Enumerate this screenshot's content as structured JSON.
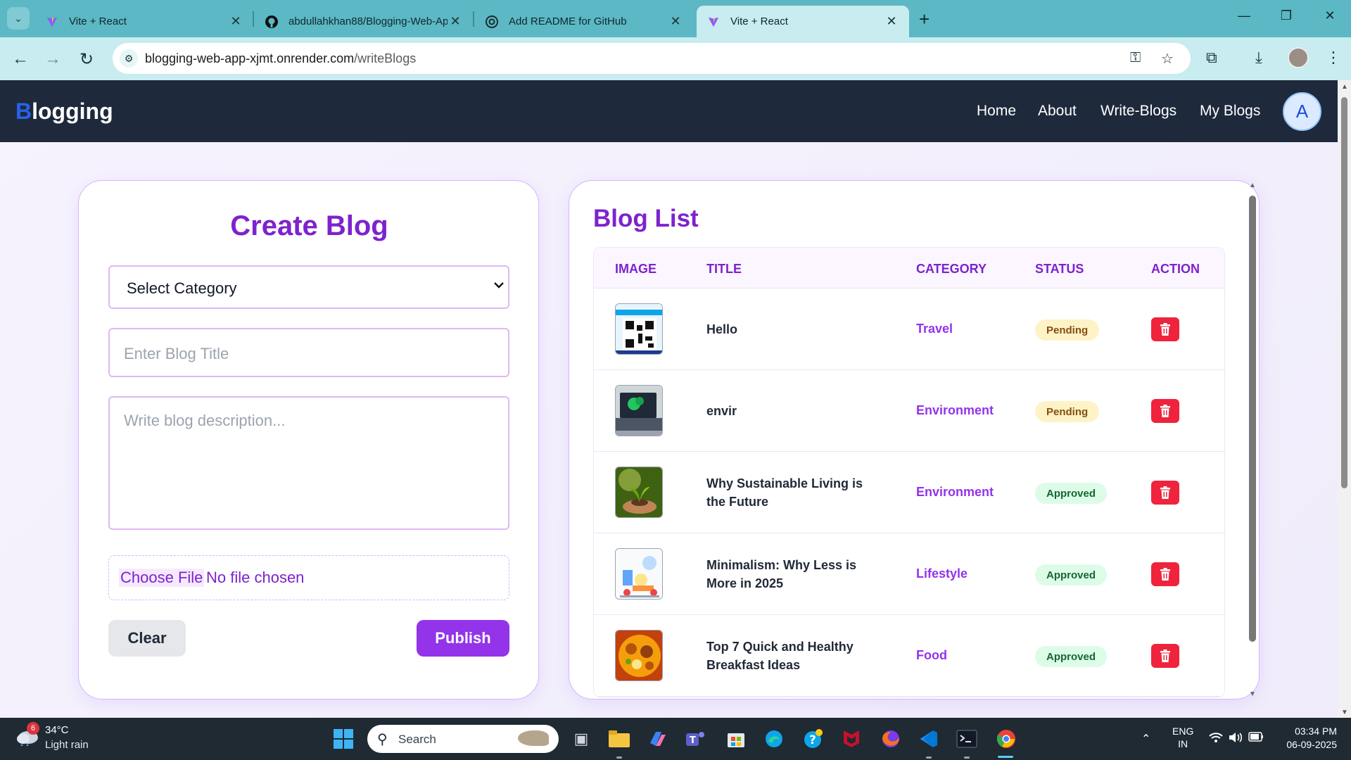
{
  "browser": {
    "tabs": [
      {
        "title": "Vite + React",
        "active": false
      },
      {
        "title": "abdullahkhan88/Blogging-Web-App",
        "active": false
      },
      {
        "title": "Add README for GitHub",
        "active": false
      },
      {
        "title": "Vite + React",
        "active": true
      }
    ],
    "new_tab": "+",
    "url_host": "blogging-web-app-xjmt.onrender.com",
    "url_path": "/writeBlogs"
  },
  "app": {
    "brand_first": "B",
    "brand_rest": "logging",
    "nav": [
      "Home",
      "About",
      "Write-Blogs",
      "My Blogs"
    ],
    "avatar_letter": "A"
  },
  "create": {
    "title": "Create Blog",
    "category_selected": "Select Category",
    "title_placeholder": "Enter Blog Title",
    "description_placeholder": "Write blog description...",
    "file_button": "Choose File",
    "file_status": "No file chosen",
    "clear_label": "Clear",
    "publish_label": "Publish"
  },
  "list": {
    "title": "Blog List",
    "columns": [
      "IMAGE",
      "TITLE",
      "CATEGORY",
      "STATUS",
      "ACTION"
    ],
    "rows": [
      {
        "title_line1": "Hello",
        "title_line2": "",
        "category": "Travel",
        "status": "Pending",
        "image": "qr-code-image"
      },
      {
        "title_line1": "envir",
        "title_line2": "",
        "category": "Environment",
        "status": "Pending",
        "image": "laptop-plant-image"
      },
      {
        "title_line1": "Why Sustainable Living is",
        "title_line2": "the Future",
        "category": "Environment",
        "status": "Approved",
        "image": "plant-in-hands-image"
      },
      {
        "title_line1": "Minimalism: Why Less is",
        "title_line2": "More in 2025",
        "category": "Lifestyle",
        "status": "Approved",
        "image": "minimalist-illustration-image"
      },
      {
        "title_line1": "Top 7 Quick and Healthy",
        "title_line2": "Breakfast Ideas",
        "category": "Food",
        "status": "Approved",
        "image": "biryani-food-image"
      }
    ]
  },
  "taskbar": {
    "weather_badge": "6",
    "temperature": "34°C",
    "condition": "Light rain",
    "search_label": "Search",
    "lang_line1": "ENG",
    "lang_line2": "IN",
    "time": "03:34 PM",
    "date": "06-09-2025"
  },
  "colors": {
    "accent": "#7e22ce",
    "publish": "#9333ea",
    "navbar": "#1e293b",
    "delete": "#ef233c",
    "tabstrip": "#5bb8c4"
  }
}
